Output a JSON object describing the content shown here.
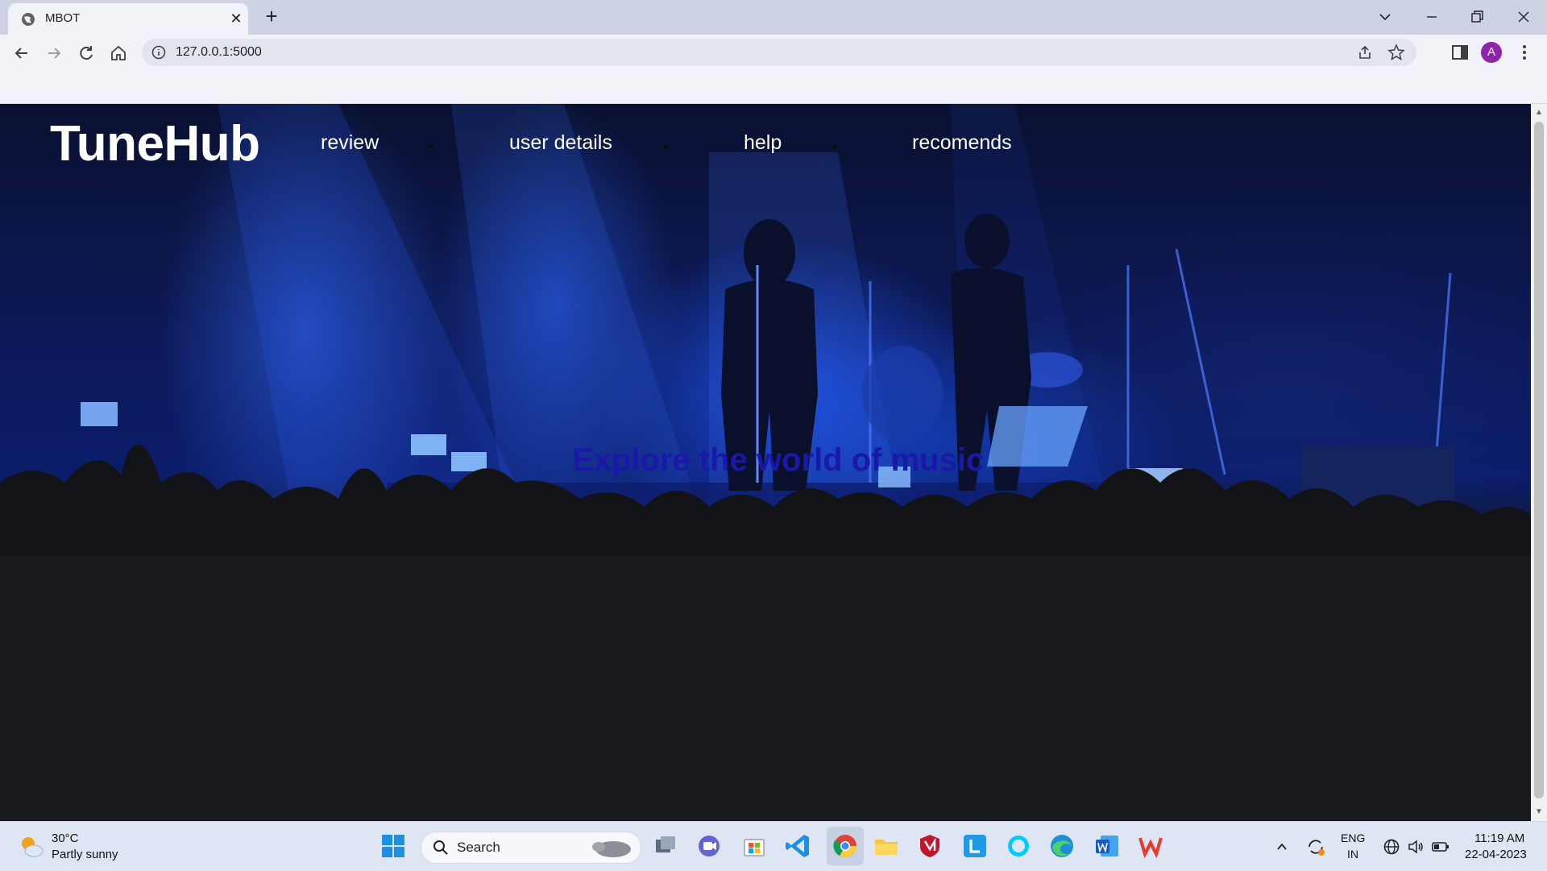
{
  "browser": {
    "tab_title": "MBOT",
    "url": "127.0.0.1:5000",
    "profile_initial": "A"
  },
  "page": {
    "brand": "TuneHub",
    "nav": [
      "review",
      "user details",
      "help",
      "recomends"
    ],
    "tagline": "Explore the world of music"
  },
  "taskbar": {
    "temperature": "30°C",
    "condition": "Partly sunny",
    "search_label": "Search",
    "lang_line1": "ENG",
    "lang_line2": "IN",
    "time": "11:19 AM",
    "date": "22-04-2023"
  },
  "colors": {
    "brand_text": "#ffffff",
    "tagline": "#1a18a8",
    "stage_blue": "#1f5cff"
  }
}
